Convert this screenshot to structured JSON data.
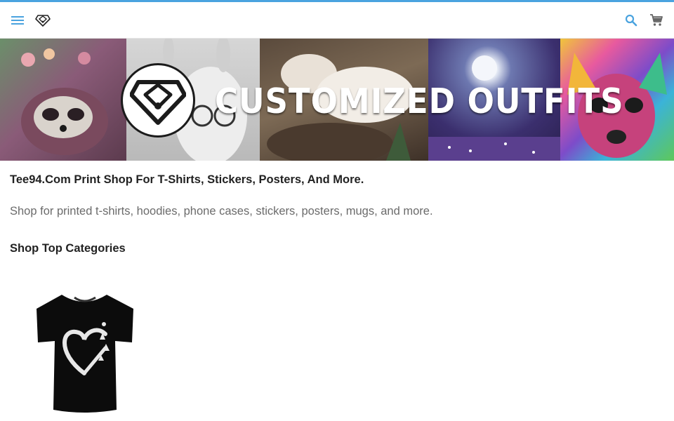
{
  "header": {
    "menu_icon": "hamburger-menu-icon",
    "logo_icon": "heart-diamond-logo-icon",
    "search_icon": "search-icon",
    "cart_icon": "shopping-cart-icon",
    "accent_color": "#4aa3df"
  },
  "banner": {
    "title": "CUSTOMIZED OUTFITS",
    "logo_icon": "heart-diamond-logo-icon"
  },
  "main": {
    "heading": "Tee94.Com Print Shop For T-Shirts, Stickers, Posters, And More.",
    "description": "Shop for printed t-shirts, hoodies, phone cases, stickers, posters, mugs, and more.",
    "categories_title": "Shop Top Categories",
    "categories": [
      {
        "image": "black-tshirt-heart-mountains",
        "icon": "tshirt-icon"
      }
    ]
  }
}
